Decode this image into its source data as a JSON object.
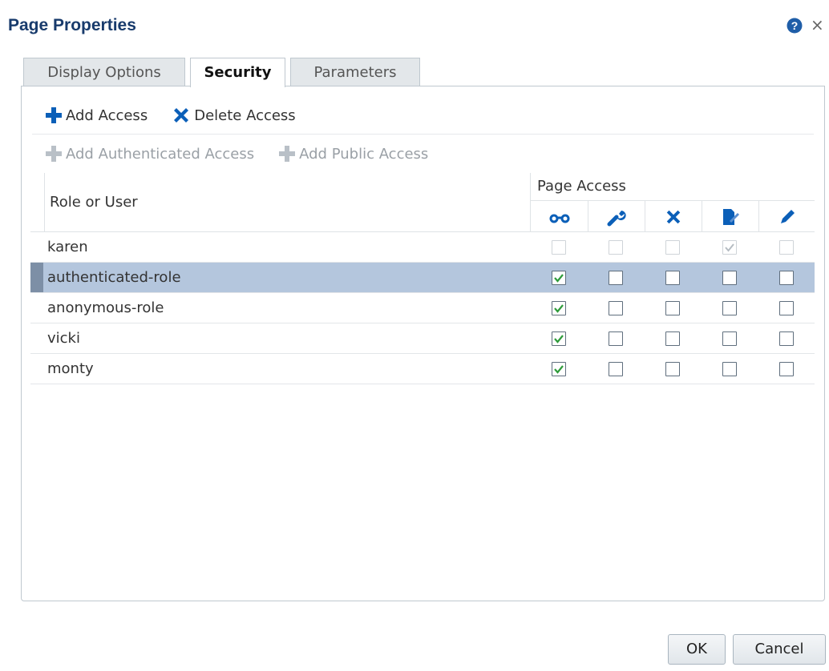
{
  "dialog": {
    "title": "Page Properties"
  },
  "tabs": [
    {
      "label": "Display Options"
    },
    {
      "label": "Security",
      "active": true
    },
    {
      "label": "Parameters"
    }
  ],
  "toolbar": {
    "add_access": "Add Access",
    "delete_access": "Delete Access",
    "add_authenticated_access": "Add Authenticated Access",
    "add_public_access": "Add Public Access"
  },
  "grid": {
    "role_header": "Role or User",
    "access_header": "Page Access",
    "columns": [
      {
        "icon": "view-glasses-icon"
      },
      {
        "icon": "wrench-icon"
      },
      {
        "icon": "delete-x-icon"
      },
      {
        "icon": "edit-document-icon"
      },
      {
        "icon": "pencil-icon"
      }
    ],
    "rows": [
      {
        "name": "karen",
        "selected": false,
        "disabled": true,
        "access": [
          false,
          false,
          false,
          true,
          false
        ]
      },
      {
        "name": "authenticated-role",
        "selected": true,
        "disabled": false,
        "access": [
          true,
          false,
          false,
          false,
          false
        ]
      },
      {
        "name": "anonymous-role",
        "selected": false,
        "disabled": false,
        "access": [
          true,
          false,
          false,
          false,
          false
        ]
      },
      {
        "name": "vicki",
        "selected": false,
        "disabled": false,
        "access": [
          true,
          false,
          false,
          false,
          false
        ]
      },
      {
        "name": "monty",
        "selected": false,
        "disabled": false,
        "access": [
          true,
          false,
          false,
          false,
          false
        ]
      }
    ]
  },
  "buttons": {
    "ok": "OK",
    "cancel": "Cancel"
  },
  "colors": {
    "title": "#183b6c",
    "icon_blue": "#0b5fb8",
    "check_green": "#2e9b3a",
    "selected_row": "#b4c6dd"
  }
}
